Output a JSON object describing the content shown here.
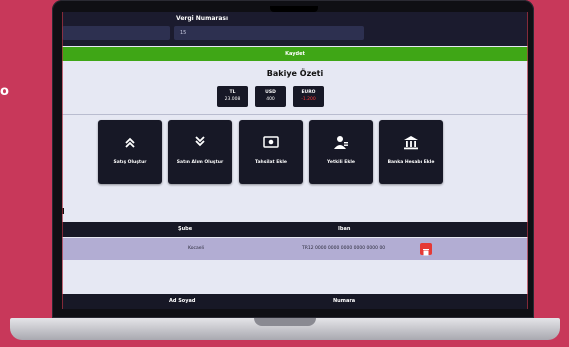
{
  "side_text": "o",
  "form": {
    "tax_label": "Vergi Numarası",
    "tax_value": "15",
    "save_label": "Kaydet"
  },
  "summary": {
    "title": "Bakiye Özeti",
    "balances": [
      {
        "currency": "TL",
        "amount": "23.008",
        "negative": false
      },
      {
        "currency": "USD",
        "amount": "400",
        "negative": false
      },
      {
        "currency": "EURO",
        "amount": "-1.200",
        "negative": true
      }
    ]
  },
  "actions": [
    {
      "label": "Satış Oluştur",
      "icon": "double-chevron-up-icon"
    },
    {
      "label": "Satın Alım Oluştur",
      "icon": "double-chevron-down-icon"
    },
    {
      "label": "Tahsilat Ekle",
      "icon": "cash-icon"
    },
    {
      "label": "Yetkili Ekle",
      "icon": "user-icon"
    },
    {
      "label": "Banka Hesabı Ekle",
      "icon": "bank-icon"
    }
  ],
  "bank_table": {
    "columns": [
      "Şube",
      "Iban"
    ],
    "rows": [
      {
        "branch": "Kocaeli",
        "iban": "TR12 0000 0000 0000 0000 0000 00"
      }
    ]
  },
  "contacts_table": {
    "columns": [
      "Ad Soyad",
      "Numara"
    ]
  }
}
